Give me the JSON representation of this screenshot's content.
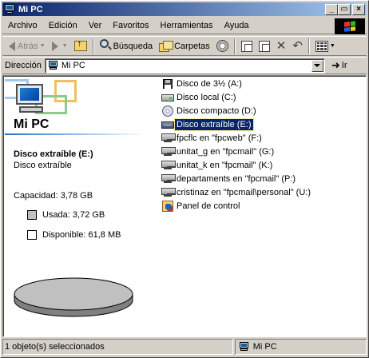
{
  "window": {
    "title": "Mi PC",
    "buttons": {
      "minimize": "_",
      "maximize": "▭",
      "close": "×"
    }
  },
  "menu": [
    "Archivo",
    "Edición",
    "Ver",
    "Favoritos",
    "Herramientas",
    "Ayuda"
  ],
  "toolbar": {
    "back_label": "Atrás",
    "search_label": "Búsqueda",
    "folders_label": "Carpetas"
  },
  "address": {
    "label": "Dirección",
    "value": "Mi PC",
    "go_label": "Ir"
  },
  "left_pane": {
    "title": "Mi PC",
    "selected_name": "Disco extraíble (E:)",
    "selected_type": "Disco extraíble",
    "capacity": "Capacidad: 3,78 GB",
    "used": "Usada: 3,72 GB",
    "free": "Disponible: 61,8 MB",
    "used_color": "#c0c0c0",
    "free_color": "#ffffff",
    "used_fraction": 0.984
  },
  "items": [
    {
      "label": "Disco de 3½ (A:)",
      "icon": "floppy-icon",
      "selected": false
    },
    {
      "label": "Disco local (C:)",
      "icon": "hard-disk-icon",
      "selected": false
    },
    {
      "label": "Disco compacto (D:)",
      "icon": "cd-drive-icon",
      "selected": false
    },
    {
      "label": "Disco extraíble (E:)",
      "icon": "removable-disk-icon",
      "selected": true
    },
    {
      "label": "fpcflc en \"fpcweb\" (F:)",
      "icon": "network-drive-icon",
      "selected": false
    },
    {
      "label": "unitat_g en \"fpcmail\" (G:)",
      "icon": "network-drive-icon",
      "selected": false
    },
    {
      "label": "unitat_k en \"fpcmail\" (K:)",
      "icon": "network-drive-icon",
      "selected": false
    },
    {
      "label": "departaments en \"fpcmail\" (P:)",
      "icon": "network-drive-icon",
      "selected": false
    },
    {
      "label": "cristinaz en \"fpcmail\\personal\" (U:)",
      "icon": "network-drive-icon",
      "selected": false
    },
    {
      "label": "Panel de control",
      "icon": "control-panel-icon",
      "selected": false
    }
  ],
  "status": {
    "left": "1 objeto(s) seleccionados",
    "right": "Mi PC"
  }
}
